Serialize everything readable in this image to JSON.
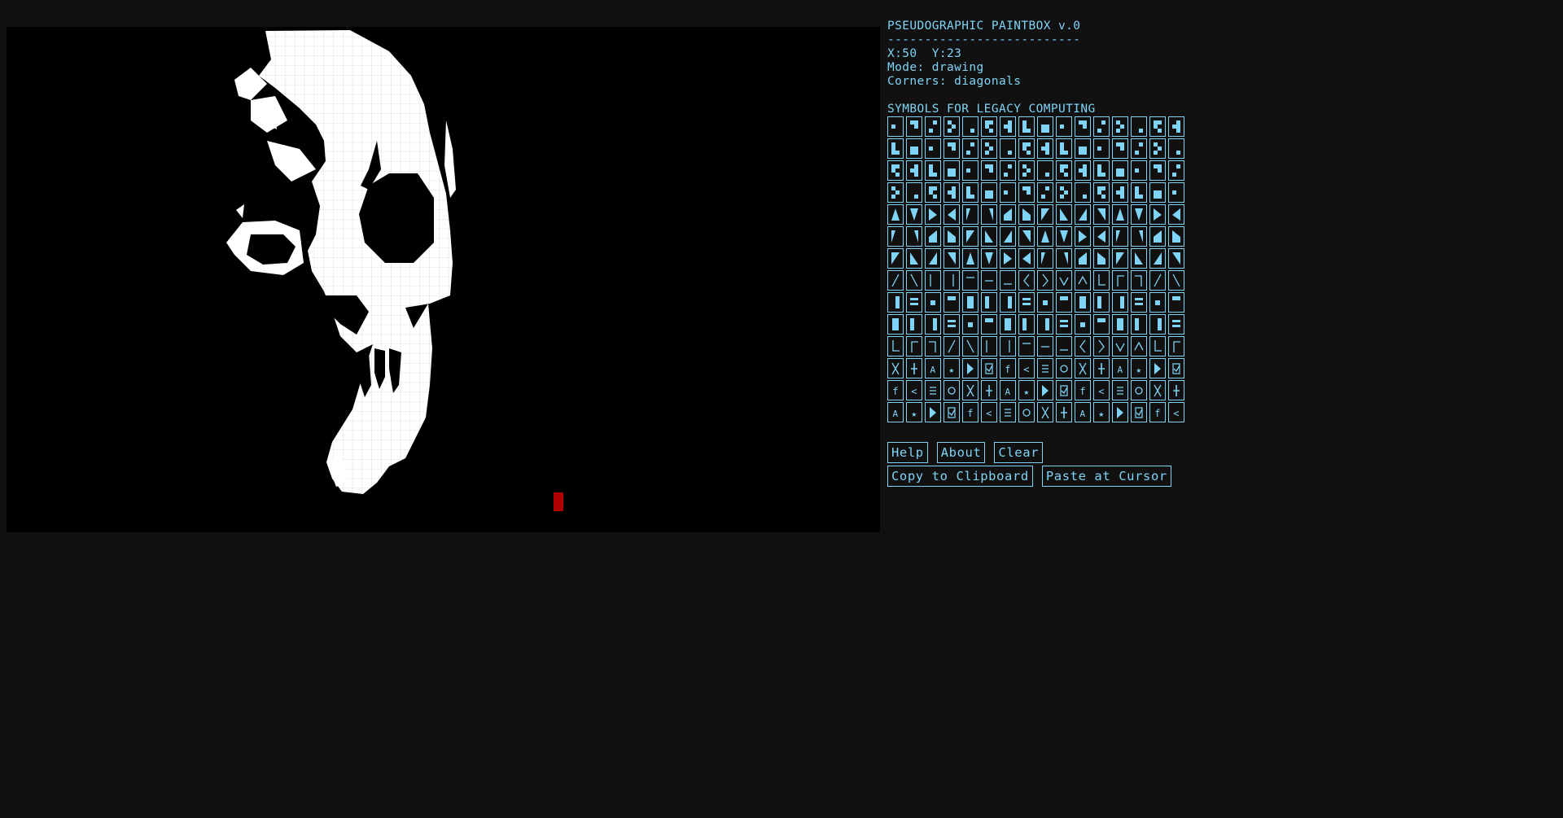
{
  "app": {
    "title": "PSEUDOGRAPHIC PAINTBOX v.0",
    "divider": "--------------------------"
  },
  "status": {
    "coords": "X:50  Y:23",
    "mode": "Mode: drawing",
    "corners": "Corners: diagonals"
  },
  "symbols": {
    "heading": "SYMBOLS FOR LEGACY COMPUTING",
    "visible_rows": 13,
    "columns": 16
  },
  "buttons": {
    "help": "Help",
    "about": "About",
    "clear": "Clear",
    "copy": "Copy to Clipboard",
    "paste": "Paste at Cursor"
  },
  "colors": {
    "background": "#111111",
    "canvas": "#000000",
    "accent": "#7fd3f5",
    "cursor": "#b00000",
    "ink": "#ffffff"
  }
}
